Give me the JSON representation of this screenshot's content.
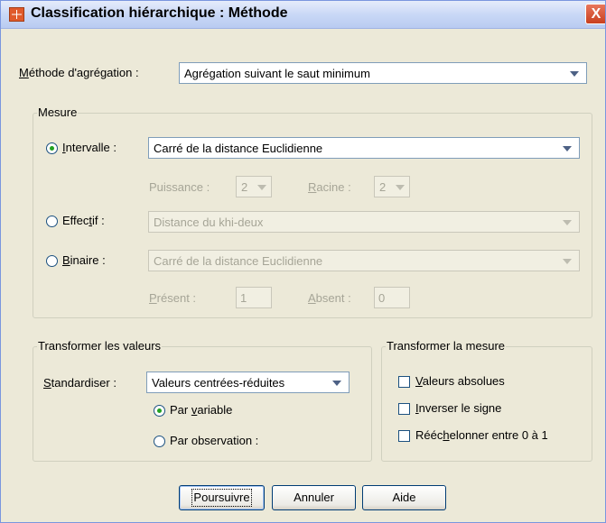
{
  "titlebar": {
    "title": "Classification hiérarchique : Méthode",
    "close_label": "X"
  },
  "method": {
    "label_pre": "",
    "label_u": "M",
    "label_post": "éthode d'agrégation :",
    "value": "Agrégation suivant le saut minimum"
  },
  "mesure": {
    "legend": "Mesure",
    "intervalle": {
      "label_u": "I",
      "label_post": "ntervalle :",
      "value": "Carré de la distance Euclidienne",
      "selected": true
    },
    "puissance": {
      "label": "Puissance :",
      "value": "2"
    },
    "racine": {
      "label_u": "R",
      "label_post": "acine :",
      "value": "2"
    },
    "effectif": {
      "label_pre": "Effec",
      "label_u": "t",
      "label_post": "if :",
      "value": "Distance du khi-deux",
      "selected": false
    },
    "binaire": {
      "label_u": "B",
      "label_post": "inaire :",
      "value": "Carré de la distance Euclidienne",
      "selected": false
    },
    "present": {
      "label_u": "P",
      "label_post": "résent :",
      "value": "1"
    },
    "absent": {
      "label_u": "A",
      "label_post": "bsent :",
      "value": "0"
    }
  },
  "transform_values": {
    "legend": "Transformer les valeurs",
    "standardiser": {
      "label_u": "S",
      "label_post": "tandardiser :",
      "value": "Valeurs centrées-réduites"
    },
    "par_variable": {
      "label_pre": "Par ",
      "label_u": "v",
      "label_post": "ariable",
      "selected": true
    },
    "par_observation": {
      "label": "Par observation :",
      "selected": false
    }
  },
  "transform_measure": {
    "legend": "Transformer la mesure",
    "valeurs_absolues": {
      "label_u": "V",
      "label_post": "aleurs absolues",
      "checked": false
    },
    "inverser": {
      "label_u": "I",
      "label_post": "nverser le signe",
      "checked": false
    },
    "reechelonner": {
      "label_pre": "Rééc",
      "label_u": "h",
      "label_post": "elonner entre 0 à 1",
      "checked": false
    }
  },
  "buttons": {
    "continue": "Poursuivre",
    "cancel": "Annuler",
    "help": "Aide"
  }
}
